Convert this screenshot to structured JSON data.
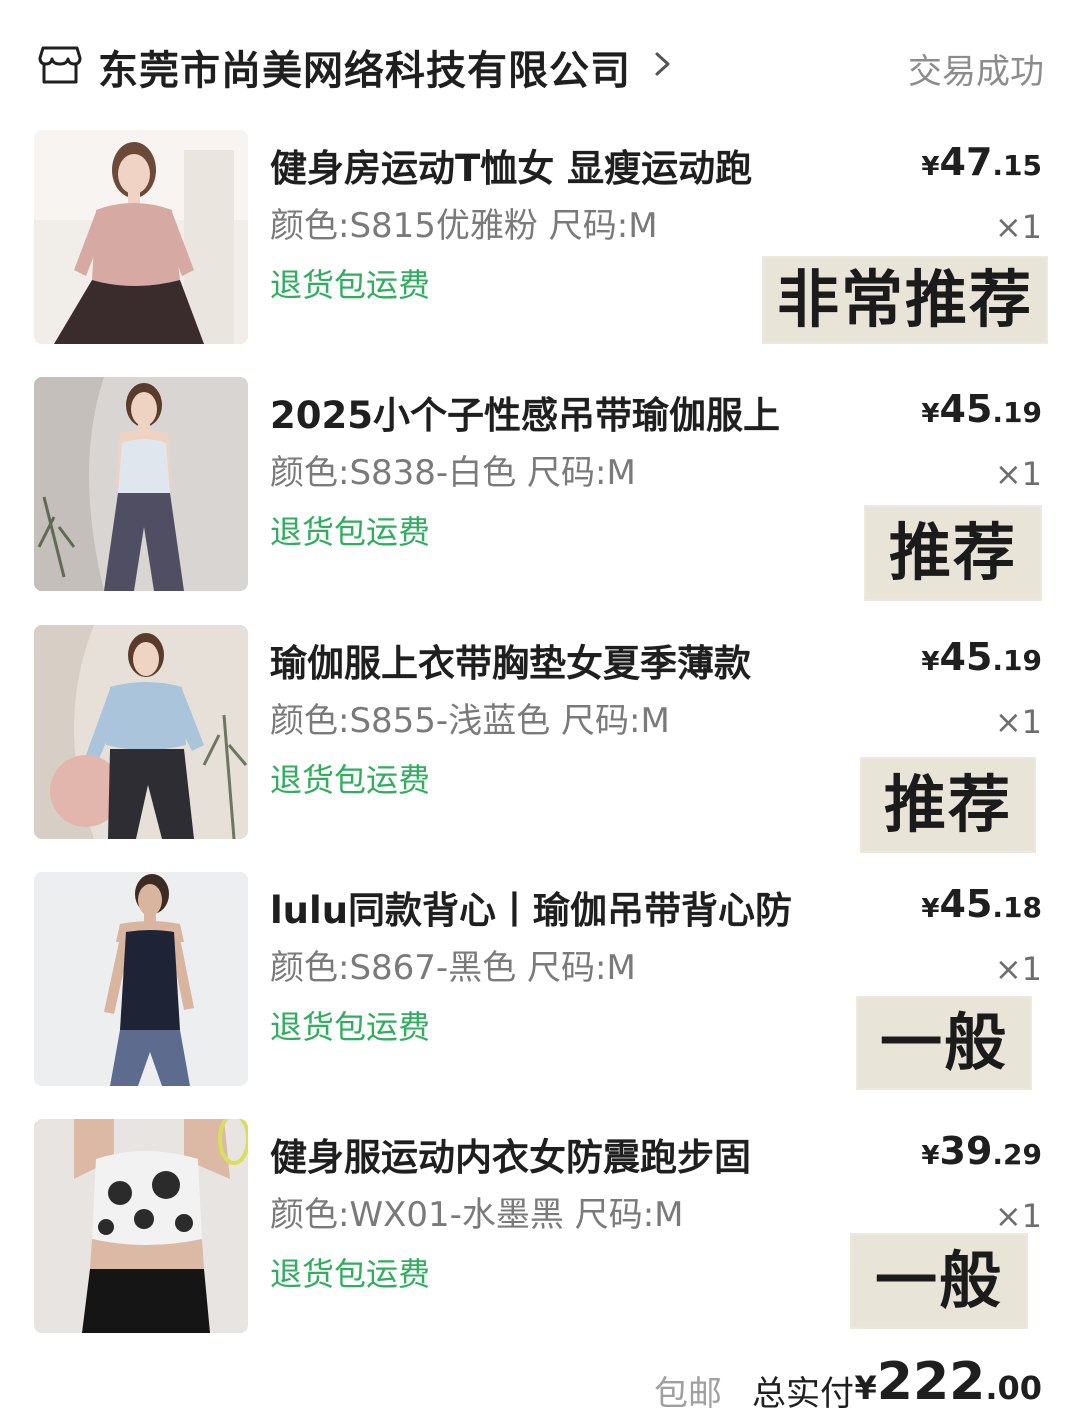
{
  "shop": {
    "name": "东莞市尚美网络科技有限公司",
    "status": "交易成功"
  },
  "items": [
    {
      "title": "健身房运动T恤女 显瘦运动跑",
      "spec": "颜色:S815优雅粉 尺码:M",
      "return_label": "退货包运费",
      "currency": "¥",
      "price_int": "47",
      "price_dec": ".15",
      "qty": "×1",
      "rating": "非常推荐",
      "image_subject": "woman in pink long-sleeve top"
    },
    {
      "title": "2025小个子性感吊带瑜伽服上",
      "spec": "颜色:S838-白色 尺码:M",
      "return_label": "退货包运费",
      "currency": "¥",
      "price_int": "45",
      "price_dec": ".19",
      "qty": "×1",
      "rating": "推荐",
      "image_subject": "woman in white tank and grey leggings"
    },
    {
      "title": "瑜伽服上衣带胸垫女夏季薄款",
      "spec": "颜色:S855-浅蓝色 尺码:M",
      "return_label": "退货包运费",
      "currency": "¥",
      "price_int": "45",
      "price_dec": ".19",
      "qty": "×1",
      "rating": "推荐",
      "image_subject": "woman in light blue top holding ball"
    },
    {
      "title": "lulu同款背心丨瑜伽吊带背心防",
      "spec": "颜色:S867-黑色 尺码:M",
      "return_label": "退货包运费",
      "currency": "¥",
      "price_int": "45",
      "price_dec": ".18",
      "qty": "×1",
      "rating": "一般",
      "image_subject": "woman in black tank top"
    },
    {
      "title": "健身服运动内衣女防震跑步固",
      "spec": "颜色:WX01-水墨黑 尺码:M",
      "return_label": "退货包运费",
      "currency": "¥",
      "price_int": "39",
      "price_dec": ".29",
      "qty": "×1",
      "rating": "一般",
      "image_subject": "woman in floral sports bra"
    }
  ],
  "footer": {
    "shipping": "包邮",
    "total_label": "总实付",
    "currency": "¥",
    "total_int": "222",
    "total_dec": ".00"
  },
  "colors": {
    "return_green": "#2fae5e",
    "rating_bg": "#e9e4d8",
    "muted_text": "#7a7a7a"
  }
}
